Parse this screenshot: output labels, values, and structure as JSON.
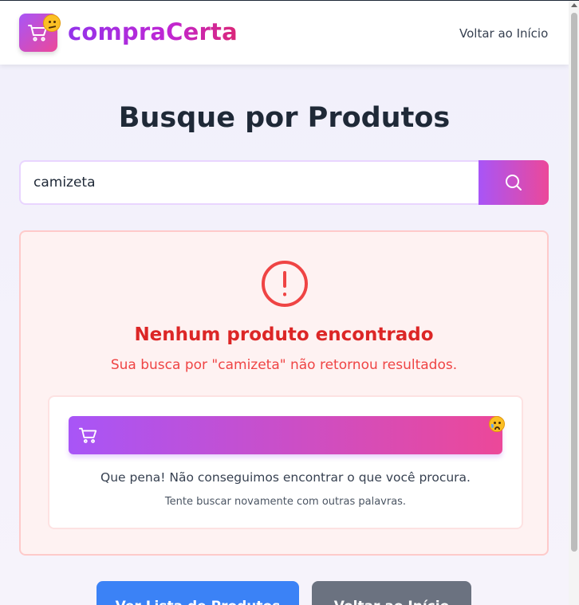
{
  "header": {
    "brand": "compraCerta",
    "nav_back": "Voltar ao Início",
    "logo_icon": "shopping-cart-icon",
    "logo_badge_icon": "confused-face-emoji"
  },
  "main": {
    "title": "Busque por Produtos",
    "search": {
      "value": "camizeta",
      "button_icon": "search-icon"
    },
    "result": {
      "icon": "alert-circle-icon",
      "title": "Nenhum produto encontrado",
      "subtitle": "Sua busca por \"camizeta\" não retornou resultados.",
      "card": {
        "bar_icon": "shopping-cart-icon",
        "badge_icon": "crying-face-emoji",
        "message": "Que pena! Não conseguimos encontrar o que você procura.",
        "hint": "Tente buscar novamente com outras palavras."
      }
    },
    "actions": {
      "list_label": "Ver Lista de Produtos",
      "home_label": "Voltar ao Início"
    }
  },
  "colors": {
    "brand_gradient_start": "#a855f7",
    "brand_gradient_end": "#ec4899",
    "error_red": "#dc2626",
    "primary_blue": "#3b82f6",
    "secondary_gray": "#6b7280"
  }
}
